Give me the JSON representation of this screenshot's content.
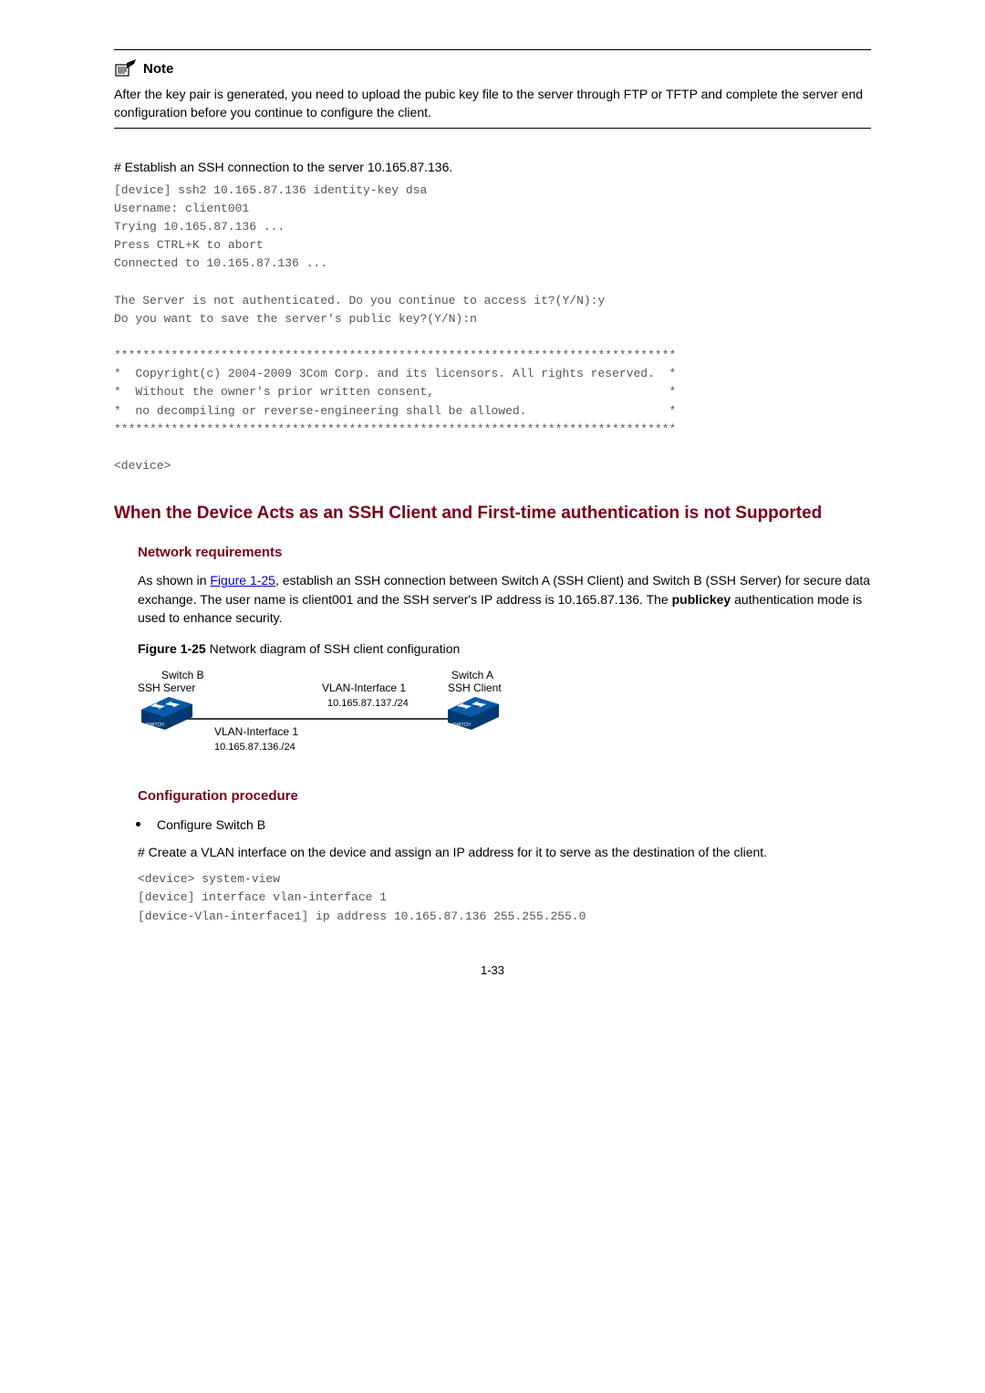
{
  "note": {
    "icon_alt": "Note",
    "label": "Note",
    "text": "After the key pair is generated, you need to upload the pubic key file to the server through FTP or TFTP and complete the server end configuration before you continue to configure the client."
  },
  "step1": {
    "heading": "# Establish an SSH connection to the server 10.165.87.136.",
    "code": "[device] ssh2 10.165.87.136 identity-key dsa\nUsername: client001\nTrying 10.165.87.136 ...\nPress CTRL+K to abort\nConnected to 10.165.87.136 ...\n\nThe Server is not authenticated. Do you continue to access it?(Y/N):y\nDo you want to save the server's public key?(Y/N):n\n\n*******************************************************************************\n*  Copyright(c) 2004-2009 3Com Corp. and its licensors. All rights reserved.  *\n*  Without the owner's prior written consent,                                 *\n*  no decompiling or reverse-engineering shall be allowed.                    *\n*******************************************************************************\n\n<device>"
  },
  "section": {
    "title": "When the Device Acts as an SSH Client and First-time authentication is not Supported"
  },
  "netreq": {
    "heading": "Network requirements",
    "para_pre": "As shown in ",
    "link": "Figure 1-25",
    "para_post": ", establish an SSH connection between Switch A (SSH Client) and Switch B (SSH Server) for secure data exchange. The user name is client001 and the SSH server's IP address is 10.165.87.136. The ",
    "bold_word": "publickey",
    "para_tail": " authentication mode is used to enhance security."
  },
  "figure": {
    "caption_prefix": "Figure 1-25 ",
    "caption_text": "Network diagram of SSH client configuration",
    "switchB_line1": "Switch B",
    "switchB_line2": "SSH Server",
    "switchA_line1": "Switch A",
    "switchA_line2": "SSH Client",
    "mid_label1": "VLAN-Interface 1",
    "mid_label2": "10.165.87.137./24",
    "bottom_label1": "VLAN-Interface 1",
    "bottom_label2": "10.165.87.136./24"
  },
  "config": {
    "heading": "Configuration procedure",
    "bullet1": "Configure Switch B",
    "para": "# Create a VLAN interface on the device and assign an IP address for it to serve as the destination of the client.",
    "code": "<device> system-view\n[device] interface vlan-interface 1\n[device-Vlan-interface1] ip address 10.165.87.136 255.255.255.0"
  },
  "pagenum": "1-33"
}
